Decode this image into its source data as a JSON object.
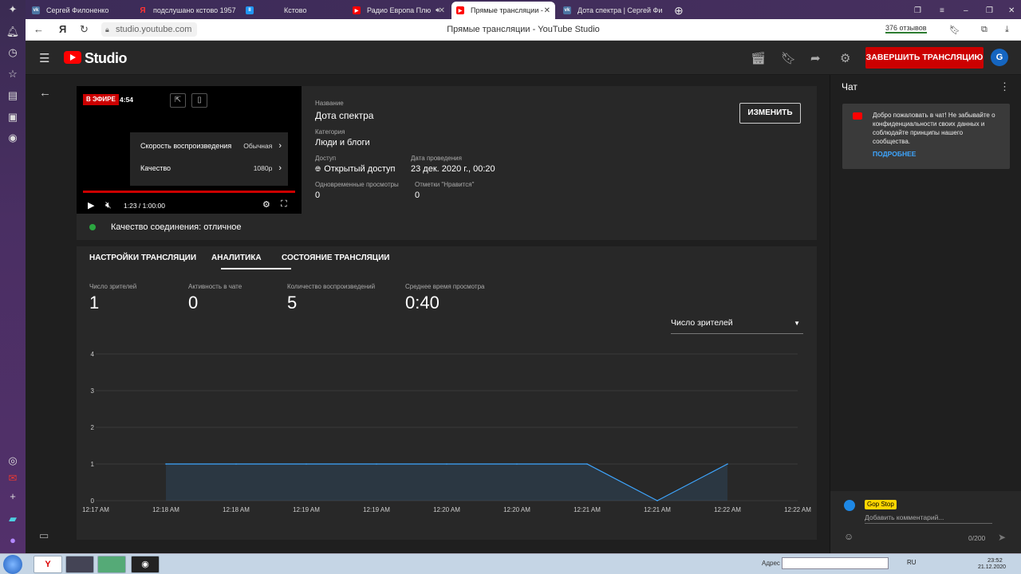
{
  "browser": {
    "tabs": [
      {
        "label": "Сергей Филоненко",
        "icon": "vk-icon"
      },
      {
        "label": "подслушано кстово 1957",
        "icon": "yandex-icon"
      },
      {
        "label": "Кстово",
        "icon": "app-icon"
      },
      {
        "label": "Радио Европа Плю",
        "icon": "youtube-icon"
      },
      {
        "label": "Прямые трансляции -",
        "icon": "youtube-icon"
      },
      {
        "label": "Дота спектра | Сергей Фи",
        "icon": "vk-icon"
      }
    ],
    "url": "studio.youtube.com",
    "page_title": "Прямые трансляции - YouTube Studio",
    "reviews": "376 отзывов"
  },
  "header": {
    "logo_text": "Studio",
    "end_stream_label": "ЗАВЕРШИТЬ ТРАНСЛЯЦИЮ",
    "avatar_letter": "G"
  },
  "player": {
    "live_badge": "В ЭФИРЕ",
    "live_time": "4:54",
    "menu": [
      {
        "label": "Скорость воспроизведения",
        "value": "Обычная"
      },
      {
        "label": "Качество",
        "value": "1080p"
      }
    ],
    "time": "1:23 / 1:00:00"
  },
  "stream_info": {
    "title_label": "Название",
    "title": "Дота спектра",
    "category_label": "Категория",
    "category": "Люди и блоги",
    "access_label": "Доступ",
    "access": "Открытый доступ",
    "date_label": "Дата проведения",
    "date": "23 дек. 2020 г., 00:20",
    "concurrent_label": "Одновременные просмотры",
    "concurrent": "0",
    "likes_label": "Отметки \"Нравится\"",
    "likes": "0",
    "edit_label": "ИЗМЕНИТЬ",
    "connection": "Качество соединения: отличное"
  },
  "analytics": {
    "tabs": [
      "НАСТРОЙКИ ТРАНСЛЯЦИИ",
      "АНАЛИТИКА",
      "СОСТОЯНИЕ ТРАНСЛЯЦИИ"
    ],
    "metrics": [
      {
        "label": "Число зрителей",
        "value": "1"
      },
      {
        "label": "Активность в чате",
        "value": "0"
      },
      {
        "label": "Количество воспроизведений",
        "value": "5"
      },
      {
        "label": "Среднее время просмотра",
        "value": "0:40"
      }
    ],
    "selected_metric": "Число зрителей"
  },
  "chart_data": {
    "type": "area",
    "x": [
      "12:17 AM",
      "12:18 AM",
      "12:18 AM",
      "12:19 AM",
      "12:19 AM",
      "12:20 AM",
      "12:20 AM",
      "12:21 AM",
      "12:21 AM",
      "12:22 AM",
      "12:22 AM"
    ],
    "values": [
      null,
      1,
      1,
      1,
      1,
      1,
      1,
      1,
      0,
      1,
      null
    ],
    "yticks": [
      0,
      1,
      2,
      3,
      4
    ],
    "ylim": [
      0,
      4
    ],
    "grid": true,
    "color": "#3ea6ff"
  },
  "chat": {
    "title": "Чат",
    "welcome": "Добро пожаловать в чат! Не забывайте о конфиденциальности своих данных и соблюдайте принципы нашего сообщества.",
    "more_link": "ПОДРОБНЕЕ",
    "user": "Gop Stop",
    "placeholder": "Добавить комментарий...",
    "counter": "0/200"
  },
  "taskbar": {
    "address_label": "Адрес",
    "lang": "RU",
    "time": "23:52",
    "date": "21.12.2020"
  }
}
